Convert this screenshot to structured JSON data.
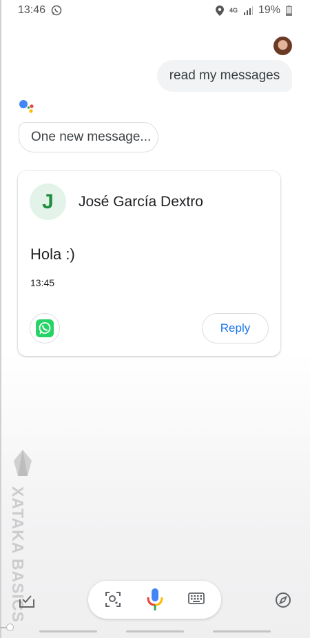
{
  "status_bar": {
    "time": "13:46",
    "network": "4G",
    "battery": "19%"
  },
  "conversation": {
    "user_query": "read my messages",
    "assistant_reply": "One new message..."
  },
  "message_card": {
    "contact_initial": "J",
    "contact_name": "José García Dextro",
    "message": "Hola :)",
    "time": "13:45",
    "reply_label": "Reply"
  },
  "watermark": {
    "text": "XATAKA BASICS"
  },
  "colors": {
    "accent_blue": "#1a73e8",
    "whatsapp_green": "#25d366",
    "avatar_green": "#1e8e3e"
  }
}
